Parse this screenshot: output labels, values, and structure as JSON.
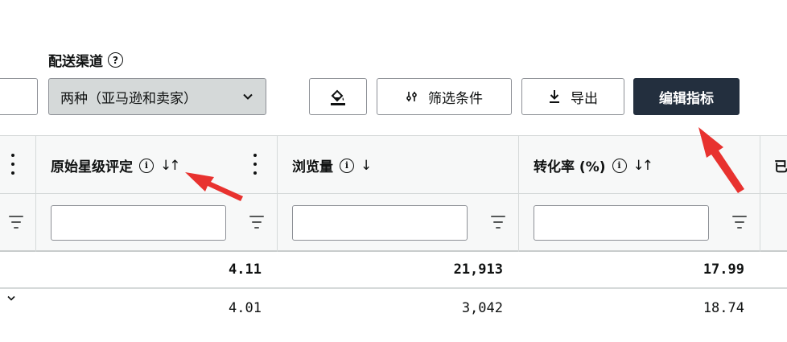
{
  "channel": {
    "label": "配送渠道",
    "help_icon": "question-circle-icon",
    "selected": "两种（亚马逊和卖家）"
  },
  "toolbar": {
    "paint_icon": "paint-bucket-icon",
    "filter_label": "筛选条件",
    "filter_icon": "sliders-icon",
    "export_label": "导出",
    "export_icon": "download-icon",
    "edit_label": "编辑指标"
  },
  "columns": [
    {
      "label": "原始星级评定",
      "info": "i",
      "sort": "↓↑"
    },
    {
      "label": "浏览量",
      "info": "i",
      "sort": "↓"
    },
    {
      "label": "转化率 (%)",
      "info": "i",
      "sort": "↓↑"
    },
    {
      "label": "已"
    }
  ],
  "totals": {
    "rating": "4.11",
    "views": "21,913",
    "conversion": "17.99"
  },
  "rows": [
    {
      "rating": "4.01",
      "views": "3,042",
      "conversion": "18.74"
    }
  ],
  "colors": {
    "primary_button": "#232f3e",
    "annotation": "#e8322f",
    "header_bg": "#f7f8f8"
  }
}
